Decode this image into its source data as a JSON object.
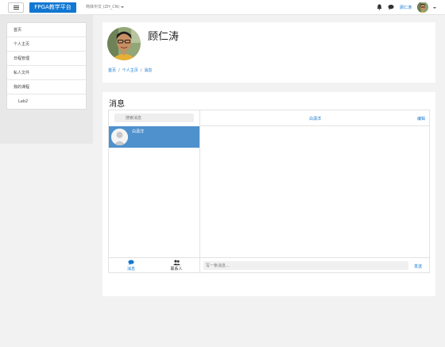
{
  "navbar": {
    "menu_icon": "hamburger-icon",
    "brand": "FPGA教学平台",
    "language": "简体中文 (ZH_CN)",
    "notification_icon": "bell-icon",
    "messages_icon": "chat-icon",
    "user_name": "顾仁涛",
    "accent_color": "#1177d1"
  },
  "drawer": {
    "items": [
      {
        "label": "首页"
      },
      {
        "label": "个人主页"
      },
      {
        "label": "日程管理"
      },
      {
        "label": "私人文件"
      },
      {
        "label": "我的课程"
      },
      {
        "label": "Lab2"
      }
    ]
  },
  "profile": {
    "name": "顾仁涛",
    "breadcrumb": [
      "首页",
      "个人主页",
      "消息"
    ]
  },
  "messages": {
    "title": "消息",
    "search_placeholder": "搜索消息",
    "contacts": [
      {
        "name": "白潇洋",
        "selected": true
      }
    ],
    "conversation_name": "白潇洋",
    "edit_label": "编辑",
    "compose_placeholder": "写一条消息...",
    "send_label": "发送",
    "tab_messages": "消息",
    "tab_contacts": "联系人",
    "selected_color": "#4f91cc"
  }
}
